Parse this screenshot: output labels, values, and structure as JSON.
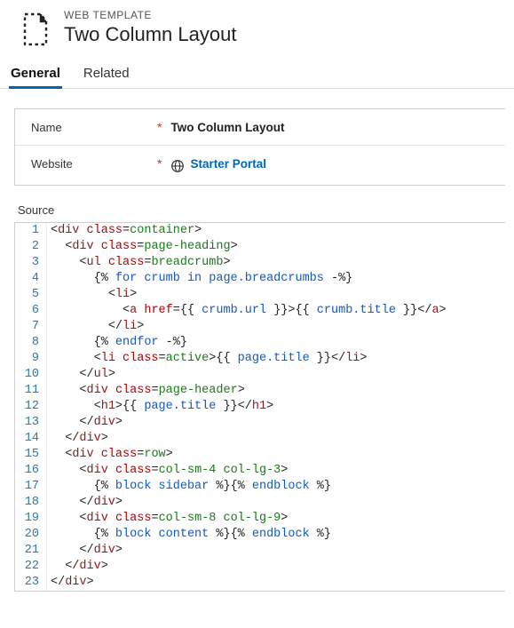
{
  "header": {
    "eyebrow": "WEB TEMPLATE",
    "title": "Two Column Layout"
  },
  "tabs": {
    "items": [
      {
        "label": "General",
        "active": true
      },
      {
        "label": "Related",
        "active": false
      }
    ]
  },
  "form": {
    "name_label": "Name",
    "name_value": "Two Column Layout",
    "website_label": "Website",
    "website_value": "Starter Portal"
  },
  "source": {
    "label": "Source",
    "lines": [
      {
        "no": 1,
        "indent": 0,
        "tokens": [
          [
            "punc",
            "<"
          ],
          [
            "tag",
            "div"
          ],
          [
            "text",
            " "
          ],
          [
            "attr",
            "class"
          ],
          [
            "punc",
            "="
          ],
          [
            "val",
            "container"
          ],
          [
            "punc",
            ">"
          ]
        ]
      },
      {
        "no": 2,
        "indent": 1,
        "tokens": [
          [
            "punc",
            "<"
          ],
          [
            "tag",
            "div"
          ],
          [
            "text",
            " "
          ],
          [
            "attr",
            "class"
          ],
          [
            "punc",
            "="
          ],
          [
            "val",
            "page-heading"
          ],
          [
            "punc",
            ">"
          ]
        ]
      },
      {
        "no": 3,
        "indent": 2,
        "tokens": [
          [
            "punc",
            "<"
          ],
          [
            "tag",
            "ul"
          ],
          [
            "text",
            " "
          ],
          [
            "attr",
            "class"
          ],
          [
            "punc",
            "="
          ],
          [
            "val",
            "breadcrumb"
          ],
          [
            "punc",
            ">"
          ]
        ]
      },
      {
        "no": 4,
        "indent": 3,
        "tokens": [
          [
            "del",
            "{% "
          ],
          [
            "liquid",
            "for"
          ],
          [
            "liquid",
            " crumb "
          ],
          [
            "liquid",
            "in"
          ],
          [
            "liquid",
            " page.breadcrumbs "
          ],
          [
            "del",
            "-%}"
          ]
        ]
      },
      {
        "no": 5,
        "indent": 4,
        "tokens": [
          [
            "punc",
            "<"
          ],
          [
            "tag",
            "li"
          ],
          [
            "punc",
            ">"
          ]
        ]
      },
      {
        "no": 6,
        "indent": 5,
        "tokens": [
          [
            "punc",
            "<"
          ],
          [
            "tag",
            "a"
          ],
          [
            "text",
            " "
          ],
          [
            "attr",
            "href"
          ],
          [
            "punc",
            "="
          ],
          [
            "del",
            "{{"
          ],
          [
            "liquid",
            " crumb.url "
          ],
          [
            "del",
            "}}"
          ],
          [
            "punc",
            ">"
          ],
          [
            "del",
            "{{"
          ],
          [
            "liquid",
            " crumb.title "
          ],
          [
            "del",
            "}}"
          ],
          [
            "punc",
            "</"
          ],
          [
            "tag",
            "a"
          ],
          [
            "punc",
            ">"
          ]
        ]
      },
      {
        "no": 7,
        "indent": 4,
        "tokens": [
          [
            "punc",
            "</"
          ],
          [
            "tag",
            "li"
          ],
          [
            "punc",
            ">"
          ]
        ]
      },
      {
        "no": 8,
        "indent": 3,
        "tokens": [
          [
            "del",
            "{% "
          ],
          [
            "liquid",
            "endfor"
          ],
          [
            "del",
            " -%}"
          ]
        ]
      },
      {
        "no": 9,
        "indent": 3,
        "tokens": [
          [
            "punc",
            "<"
          ],
          [
            "tag",
            "li"
          ],
          [
            "text",
            " "
          ],
          [
            "attr",
            "class"
          ],
          [
            "punc",
            "="
          ],
          [
            "val",
            "active"
          ],
          [
            "punc",
            ">"
          ],
          [
            "del",
            "{{"
          ],
          [
            "liquid",
            " page.title "
          ],
          [
            "del",
            "}}"
          ],
          [
            "punc",
            "</"
          ],
          [
            "tag",
            "li"
          ],
          [
            "punc",
            ">"
          ]
        ]
      },
      {
        "no": 10,
        "indent": 2,
        "tokens": [
          [
            "punc",
            "</"
          ],
          [
            "tag",
            "ul"
          ],
          [
            "punc",
            ">"
          ]
        ]
      },
      {
        "no": 11,
        "indent": 2,
        "tokens": [
          [
            "punc",
            "<"
          ],
          [
            "tag",
            "div"
          ],
          [
            "text",
            " "
          ],
          [
            "attr",
            "class"
          ],
          [
            "punc",
            "="
          ],
          [
            "val",
            "page-header"
          ],
          [
            "punc",
            ">"
          ]
        ]
      },
      {
        "no": 12,
        "indent": 3,
        "tokens": [
          [
            "punc",
            "<"
          ],
          [
            "tag",
            "h1"
          ],
          [
            "punc",
            ">"
          ],
          [
            "del",
            "{{"
          ],
          [
            "liquid",
            " page.title "
          ],
          [
            "del",
            "}}"
          ],
          [
            "punc",
            "</"
          ],
          [
            "tag",
            "h1"
          ],
          [
            "punc",
            ">"
          ]
        ]
      },
      {
        "no": 13,
        "indent": 2,
        "tokens": [
          [
            "punc",
            "</"
          ],
          [
            "tag",
            "div"
          ],
          [
            "punc",
            ">"
          ]
        ]
      },
      {
        "no": 14,
        "indent": 1,
        "tokens": [
          [
            "punc",
            "</"
          ],
          [
            "tag",
            "div"
          ],
          [
            "punc",
            ">"
          ]
        ]
      },
      {
        "no": 15,
        "indent": 1,
        "tokens": [
          [
            "punc",
            "<"
          ],
          [
            "tag",
            "div"
          ],
          [
            "text",
            " "
          ],
          [
            "attr",
            "class"
          ],
          [
            "punc",
            "="
          ],
          [
            "val",
            "row"
          ],
          [
            "punc",
            ">"
          ]
        ]
      },
      {
        "no": 16,
        "indent": 2,
        "tokens": [
          [
            "punc",
            "<"
          ],
          [
            "tag",
            "div"
          ],
          [
            "text",
            " "
          ],
          [
            "attr",
            "class"
          ],
          [
            "punc",
            "="
          ],
          [
            "val",
            "col-sm-4 col-lg-3"
          ],
          [
            "punc",
            ">"
          ]
        ]
      },
      {
        "no": 17,
        "indent": 3,
        "tokens": [
          [
            "del",
            "{% "
          ],
          [
            "liquid",
            "block"
          ],
          [
            "liquid",
            " sidebar "
          ],
          [
            "del",
            "%}"
          ],
          [
            "del",
            "{% "
          ],
          [
            "liquid",
            "endblock"
          ],
          [
            "del",
            " %}"
          ]
        ]
      },
      {
        "no": 18,
        "indent": 2,
        "tokens": [
          [
            "punc",
            "</"
          ],
          [
            "tag",
            "div"
          ],
          [
            "punc",
            ">"
          ]
        ]
      },
      {
        "no": 19,
        "indent": 2,
        "tokens": [
          [
            "punc",
            "<"
          ],
          [
            "tag",
            "div"
          ],
          [
            "text",
            " "
          ],
          [
            "attr",
            "class"
          ],
          [
            "punc",
            "="
          ],
          [
            "val",
            "col-sm-8 col-lg-9"
          ],
          [
            "punc",
            ">"
          ]
        ]
      },
      {
        "no": 20,
        "indent": 3,
        "tokens": [
          [
            "del",
            "{% "
          ],
          [
            "liquid",
            "block"
          ],
          [
            "liquid",
            " content "
          ],
          [
            "del",
            "%}"
          ],
          [
            "del",
            "{% "
          ],
          [
            "liquid",
            "endblock"
          ],
          [
            "del",
            " %}"
          ]
        ]
      },
      {
        "no": 21,
        "indent": 2,
        "tokens": [
          [
            "punc",
            "</"
          ],
          [
            "tag",
            "div"
          ],
          [
            "punc",
            ">"
          ]
        ]
      },
      {
        "no": 22,
        "indent": 1,
        "tokens": [
          [
            "punc",
            "</"
          ],
          [
            "tag",
            "div"
          ],
          [
            "punc",
            ">"
          ]
        ]
      },
      {
        "no": 23,
        "indent": 0,
        "tokens": [
          [
            "punc",
            "</"
          ],
          [
            "tag",
            "div"
          ],
          [
            "punc",
            ">"
          ]
        ]
      }
    ]
  }
}
